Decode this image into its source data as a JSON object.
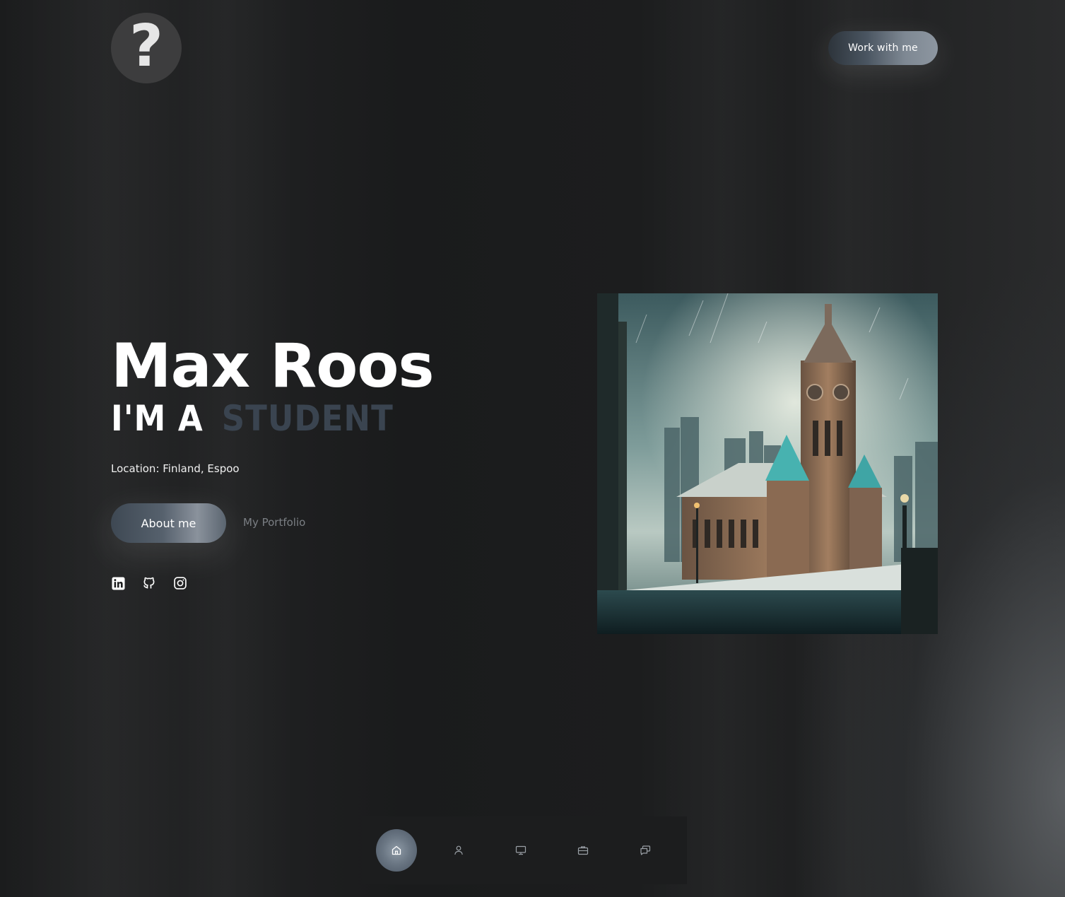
{
  "header": {
    "logo": {
      "glyph": "?",
      "icon": "question-mark-icon"
    },
    "work_button_label": "Work with me"
  },
  "hero": {
    "name": "Max Roos",
    "role_prefix": "I'M A",
    "role_word": "STUDENT",
    "location": "Location: Finland, Espoo",
    "about_button_label": "About me",
    "portfolio_link_label": "My Portfolio",
    "socials": [
      {
        "name": "linkedin-icon"
      },
      {
        "name": "github-icon"
      },
      {
        "name": "instagram-icon"
      }
    ],
    "image": {
      "subject": "snowy-gothic-city-illustration"
    }
  },
  "dock": {
    "items": [
      {
        "icon": "home-icon",
        "active": true
      },
      {
        "icon": "user-icon",
        "active": false
      },
      {
        "icon": "monitor-icon",
        "active": false
      },
      {
        "icon": "briefcase-icon",
        "active": false
      },
      {
        "icon": "chat-icon",
        "active": false
      }
    ]
  },
  "colors": {
    "accent_gradient_dark": "#3e4853",
    "accent_gradient_light": "#8a929c",
    "role_word": "#3a4450",
    "link_muted": "#7b7f84"
  }
}
